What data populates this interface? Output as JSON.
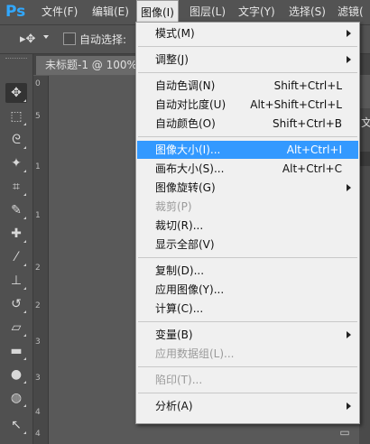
{
  "app": {
    "logo": "Ps"
  },
  "menubar": {
    "items": [
      {
        "label": "文件(F)"
      },
      {
        "label": "编辑(E)"
      },
      {
        "label": "图像(I)"
      },
      {
        "label": "图层(L)"
      },
      {
        "label": "文字(Y)"
      },
      {
        "label": "选择(S)"
      },
      {
        "label": "滤镜("
      }
    ]
  },
  "options": {
    "auto_select_label": "自动选择:",
    "move_icon": "move-icon"
  },
  "tab": {
    "title": "未标题-1 @ 100%"
  },
  "ruler": {
    "ticks": [
      "0",
      "5",
      "1",
      "1",
      "2",
      "2",
      "3",
      "3",
      "4",
      "4"
    ]
  },
  "right_panel": {
    "label": "文"
  },
  "image_menu": {
    "groups": [
      [
        {
          "label": "模式(M)",
          "shortcut": "",
          "submenu": true,
          "disabled": false
        }
      ],
      [
        {
          "label": "调整(J)",
          "shortcut": "",
          "submenu": true,
          "disabled": false
        }
      ],
      [
        {
          "label": "自动色调(N)",
          "shortcut": "Shift+Ctrl+L",
          "submenu": false,
          "disabled": false
        },
        {
          "label": "自动对比度(U)",
          "shortcut": "Alt+Shift+Ctrl+L",
          "submenu": false,
          "disabled": false
        },
        {
          "label": "自动颜色(O)",
          "shortcut": "Shift+Ctrl+B",
          "submenu": false,
          "disabled": false
        }
      ],
      [
        {
          "label": "图像大小(I)...",
          "shortcut": "Alt+Ctrl+I",
          "submenu": false,
          "disabled": false,
          "highlighted": true
        },
        {
          "label": "画布大小(S)...",
          "shortcut": "Alt+Ctrl+C",
          "submenu": false,
          "disabled": false
        },
        {
          "label": "图像旋转(G)",
          "shortcut": "",
          "submenu": true,
          "disabled": false
        },
        {
          "label": "裁剪(P)",
          "shortcut": "",
          "submenu": false,
          "disabled": true
        },
        {
          "label": "裁切(R)...",
          "shortcut": "",
          "submenu": false,
          "disabled": false
        },
        {
          "label": "显示全部(V)",
          "shortcut": "",
          "submenu": false,
          "disabled": false
        }
      ],
      [
        {
          "label": "复制(D)...",
          "shortcut": "",
          "submenu": false,
          "disabled": false
        },
        {
          "label": "应用图像(Y)...",
          "shortcut": "",
          "submenu": false,
          "disabled": false
        },
        {
          "label": "计算(C)...",
          "shortcut": "",
          "submenu": false,
          "disabled": false
        }
      ],
      [
        {
          "label": "变量(B)",
          "shortcut": "",
          "submenu": true,
          "disabled": false
        },
        {
          "label": "应用数据组(L)...",
          "shortcut": "",
          "submenu": false,
          "disabled": true
        }
      ],
      [
        {
          "label": "陷印(T)...",
          "shortcut": "",
          "submenu": false,
          "disabled": true
        }
      ],
      [
        {
          "label": "分析(A)",
          "shortcut": "",
          "submenu": true,
          "disabled": false
        }
      ]
    ]
  },
  "colors": {
    "highlight": "#3399ff",
    "menu_bg": "#f0f0f0",
    "ui_dark": "#535353"
  }
}
